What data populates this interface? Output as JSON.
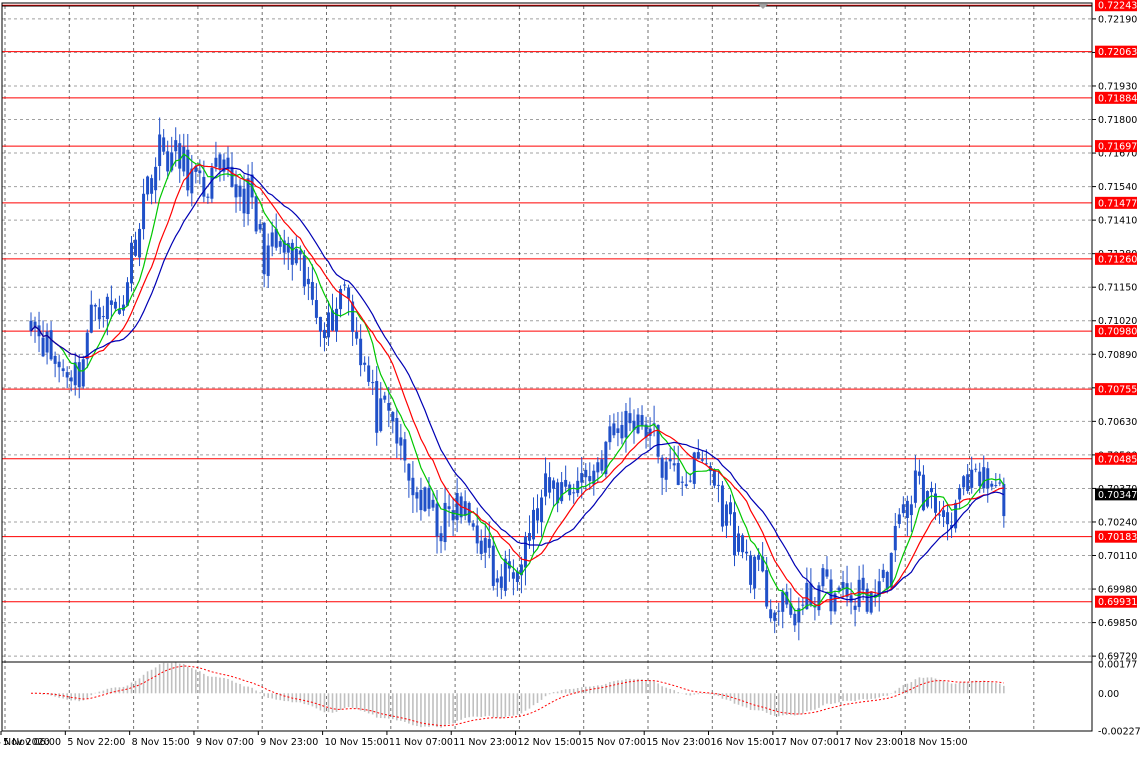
{
  "chart_data": {
    "type": "candlestick",
    "instrument_timeframe": "",
    "price_ticks": [
      "0.72190",
      "0.72060",
      "0.71930",
      "0.71800",
      "0.71670",
      "0.71540",
      "0.71410",
      "0.71280",
      "0.71150",
      "0.71020",
      "0.70890",
      "0.70760",
      "0.70630",
      "0.70500",
      "0.70370",
      "0.70240",
      "0.70110",
      "0.69980",
      "0.69850",
      "0.69720"
    ],
    "ylim": [
      0.69705,
      0.7224
    ],
    "current_price": "0.70347",
    "levels": [
      {
        "label": "0.72243",
        "value": 0.72243
      },
      {
        "label": "0.72063",
        "value": 0.72063
      },
      {
        "label": "0.71884",
        "value": 0.71884
      },
      {
        "label": "0.71697",
        "value": 0.71697
      },
      {
        "label": "0.71477",
        "value": 0.71477
      },
      {
        "label": "0.71260",
        "value": 0.7126
      },
      {
        "label": "0.70980",
        "value": 0.7098
      },
      {
        "label": "0.70755",
        "value": 0.70755
      },
      {
        "label": "0.70485",
        "value": 0.70485
      },
      {
        "label": "0.70183",
        "value": 0.70183
      },
      {
        "label": "0.69931",
        "value": 0.69931
      }
    ],
    "time_labels": [
      "4 Nov 2020",
      "5 Nov 06:00",
      "5 Nov 22:00",
      "8 Nov 15:00",
      "9 Nov 07:00",
      "9 Nov 23:00",
      "10 Nov 15:00",
      "11 Nov 07:00",
      "11 Nov 23:00",
      "12 Nov 15:00",
      "15 Nov 07:00",
      "15 Nov 23:00",
      "16 Nov 15:00",
      "17 Nov 07:00",
      "17 Nov 23:00",
      "18 Nov 15:00"
    ],
    "time_label_index": [
      -2,
      0,
      16,
      32,
      48,
      64,
      80,
      96,
      112,
      128,
      144,
      160,
      176,
      192,
      208,
      224
    ],
    "close_anchors": [
      [
        0,
        0.7106
      ],
      [
        6,
        0.7085
      ],
      [
        12,
        0.7082
      ],
      [
        16,
        0.711
      ],
      [
        22,
        0.7105
      ],
      [
        28,
        0.715
      ],
      [
        32,
        0.7168
      ],
      [
        38,
        0.7163
      ],
      [
        42,
        0.7152
      ],
      [
        46,
        0.7158
      ],
      [
        50,
        0.7155
      ],
      [
        54,
        0.715
      ],
      [
        58,
        0.7128
      ],
      [
        62,
        0.713
      ],
      [
        66,
        0.7123
      ],
      [
        70,
        0.711
      ],
      [
        74,
        0.71
      ],
      [
        78,
        0.7118
      ],
      [
        82,
        0.709
      ],
      [
        86,
        0.7065
      ],
      [
        90,
        0.7062
      ],
      [
        94,
        0.704
      ],
      [
        98,
        0.703
      ],
      [
        102,
        0.7022
      ],
      [
        106,
        0.703
      ],
      [
        110,
        0.7022
      ],
      [
        112,
        0.7018
      ],
      [
        116,
        0.6998
      ],
      [
        120,
        0.701
      ],
      [
        124,
        0.702
      ],
      [
        128,
        0.7035
      ],
      [
        132,
        0.7037
      ],
      [
        136,
        0.704
      ],
      [
        140,
        0.7044
      ],
      [
        144,
        0.7056
      ],
      [
        150,
        0.7066
      ],
      [
        154,
        0.706
      ],
      [
        158,
        0.7042
      ],
      [
        164,
        0.7043
      ],
      [
        168,
        0.7048
      ],
      [
        172,
        0.703
      ],
      [
        176,
        0.7015
      ],
      [
        180,
        0.7005
      ],
      [
        184,
        0.6992
      ],
      [
        188,
        0.6988
      ],
      [
        192,
        0.699
      ],
      [
        196,
        0.7
      ],
      [
        200,
        0.6995
      ],
      [
        204,
        0.6995
      ],
      [
        208,
        0.6995
      ],
      [
        212,
        0.7
      ],
      [
        216,
        0.7022
      ],
      [
        220,
        0.704
      ],
      [
        224,
        0.703
      ],
      [
        228,
        0.7028
      ],
      [
        232,
        0.7034
      ],
      [
        236,
        0.704
      ],
      [
        240,
        0.7035
      ],
      [
        242,
        0.7032
      ]
    ],
    "moving_average_periods": [
      8,
      14,
      21
    ],
    "moving_average_colors": [
      "#00c800",
      "#ff0000",
      "#0000b4"
    ],
    "indicator_ticks": [
      "0.00177",
      "0.00",
      "-0.002277"
    ],
    "indicator_ylim": [
      -0.002277,
      0.00177
    ]
  },
  "colors": {
    "candle": "#2050c8",
    "level_line": "#ff0000",
    "level_tag": "#ff0000",
    "grid": "#a0a0a0",
    "osc_bar": "#c0c0c0",
    "osc_signal": "#ff0000",
    "price_tag": "#000000"
  }
}
